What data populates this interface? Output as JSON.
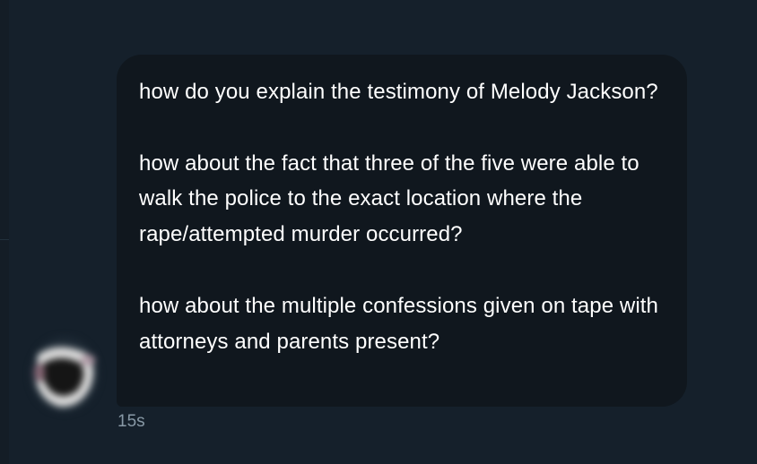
{
  "conversation": {
    "message": {
      "paragraphs": [
        "how do you explain the testimony of Melody Jackson?",
        "how about the fact that three of the five were able to walk the police to the exact location where the rape/attempted murder occurred?",
        "how about the multiple confessions given on tape with attorneys and parents present?"
      ],
      "timestamp": "15s"
    },
    "sender": {
      "avatar": "blurred-avatar"
    }
  },
  "colors": {
    "background": "#15202b",
    "bubble": "#10171e",
    "text": "#ffffff",
    "timestamp": "#8899a6"
  }
}
